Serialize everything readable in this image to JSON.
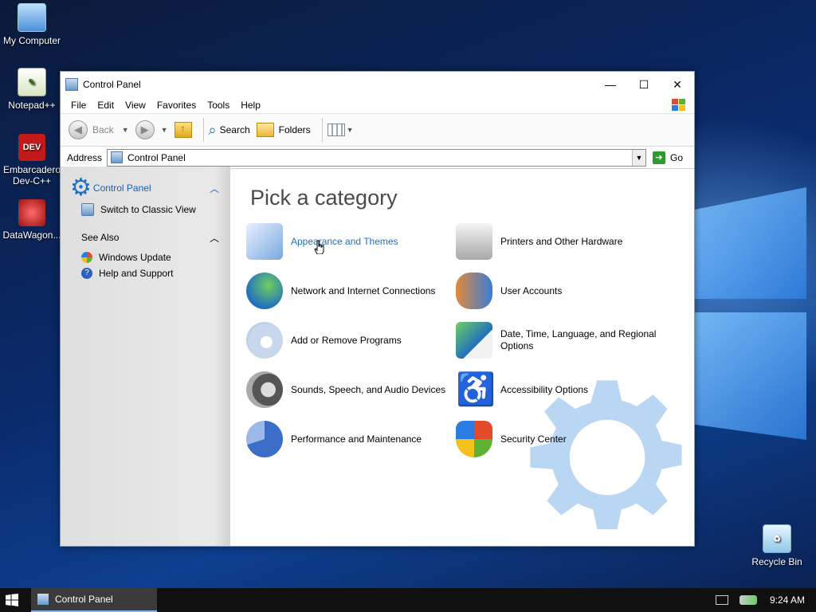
{
  "desktop": {
    "icons": [
      {
        "label": "My Computer"
      },
      {
        "label": "Notepad++"
      },
      {
        "label": "Embarcadero Dev-C++"
      },
      {
        "label": "DataWagon..."
      },
      {
        "label": "Recycle Bin"
      }
    ]
  },
  "window": {
    "title": "Control Panel",
    "controls": {
      "minimize": "—",
      "maximize": "☐",
      "close": "✕"
    },
    "menu": [
      "File",
      "Edit",
      "View",
      "Favorites",
      "Tools",
      "Help"
    ],
    "toolbar": {
      "back": "Back",
      "search": "Search",
      "folders": "Folders"
    },
    "address": {
      "label": "Address",
      "value": "Control Panel",
      "go": "Go"
    }
  },
  "left_pane": {
    "header": "Control Panel",
    "switch_view": "Switch to Classic View",
    "see_also_title": "See Also",
    "see_also_items": [
      "Windows Update",
      "Help and Support"
    ]
  },
  "main": {
    "heading": "Pick a category",
    "categories": [
      {
        "label": "Appearance and Themes",
        "hover": true
      },
      {
        "label": "Printers and Other Hardware"
      },
      {
        "label": "Network and Internet Connections"
      },
      {
        "label": "User Accounts"
      },
      {
        "label": "Add or Remove Programs"
      },
      {
        "label": "Date, Time, Language, and Regional Options"
      },
      {
        "label": "Sounds, Speech, and Audio Devices"
      },
      {
        "label": "Accessibility Options"
      },
      {
        "label": "Performance and Maintenance"
      },
      {
        "label": "Security Center"
      }
    ]
  },
  "taskbar": {
    "active_task": "Control Panel",
    "clock": "9:24 AM"
  },
  "colors": {
    "link_blue": "#1e6fc7",
    "accent": "#1b5fb5"
  }
}
